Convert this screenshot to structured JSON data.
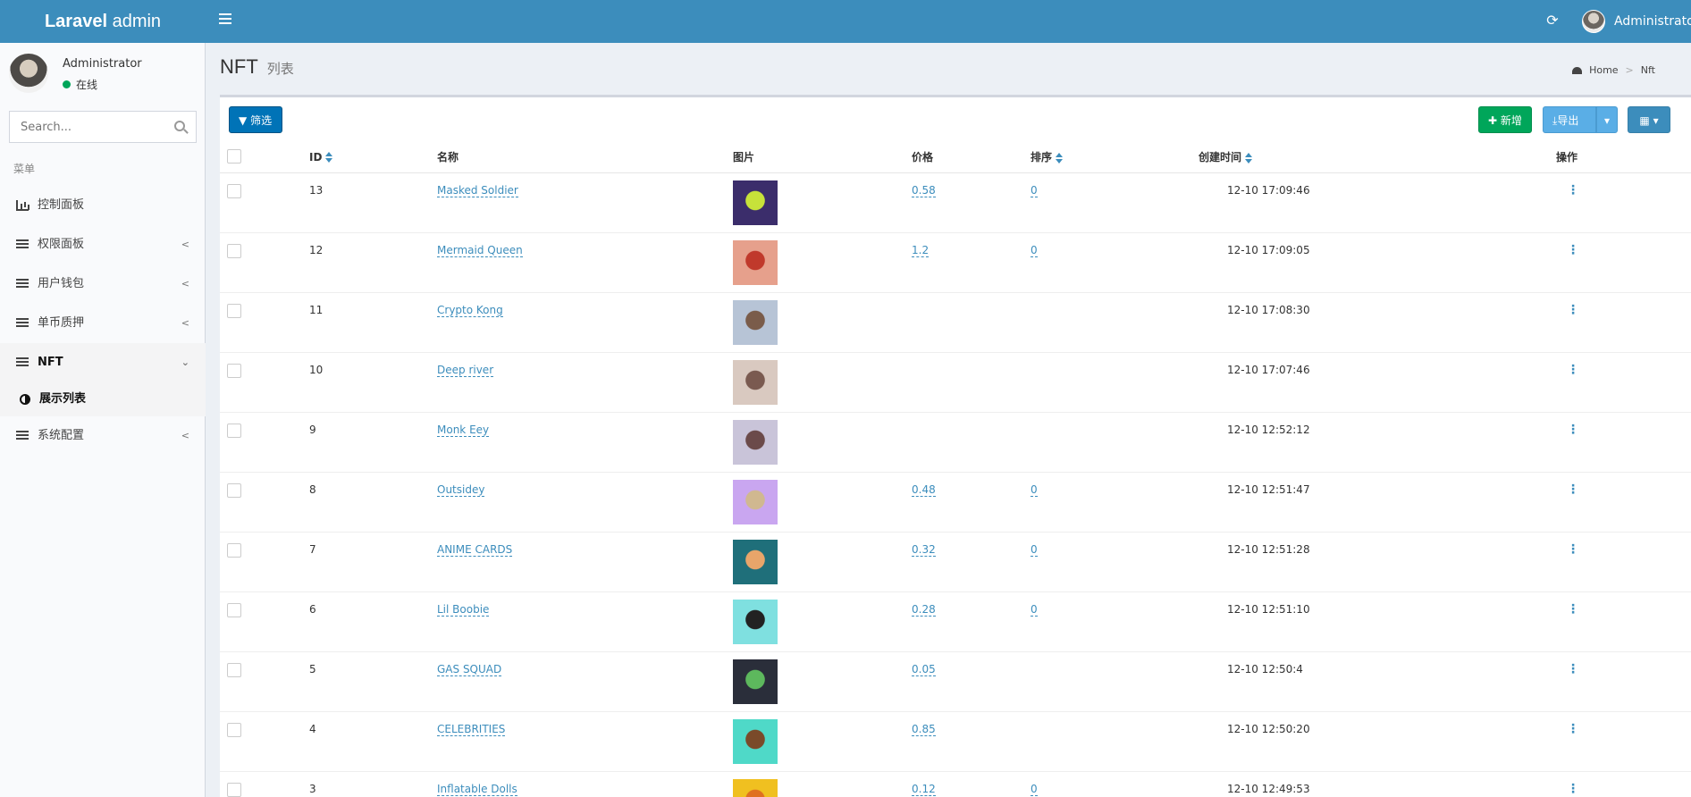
{
  "header": {
    "logo_bold": "Laravel",
    "logo_rest": " admin",
    "user_name": "Administrator"
  },
  "sidebar": {
    "user_name": "Administrator",
    "status": "在线",
    "search_placeholder": "Search...",
    "menu_header": "菜单",
    "items": [
      {
        "label": "控制面板"
      },
      {
        "label": "权限面板"
      },
      {
        "label": "用户钱包"
      },
      {
        "label": "单币质押"
      },
      {
        "label": "NFT"
      },
      {
        "label": "展示列表"
      },
      {
        "label": "系统配置"
      }
    ]
  },
  "content": {
    "title": "NFT",
    "subtitle": "列表",
    "breadcrumb": [
      "Home",
      "Nft"
    ]
  },
  "toolbar": {
    "filter": "筛选",
    "new": "新增",
    "export": "导出"
  },
  "table": {
    "headers": [
      "ID",
      "名称",
      "图片",
      "价格",
      "排序",
      "创建时间",
      "操作"
    ],
    "rows": [
      {
        "id": "13",
        "name": "Masked Soldier",
        "price": "0.58",
        "sort": "0",
        "time": "12-10 17:09:46",
        "c1": "#3b2d6b",
        "c2": "#c7e23a"
      },
      {
        "id": "12",
        "name": "Mermaid Queen",
        "price": "1.2",
        "sort": "0",
        "time": "12-10 17:09:05",
        "c1": "#e6a08c",
        "c2": "#c0392b"
      },
      {
        "id": "11",
        "name": "Crypto Kong",
        "price": "",
        "sort": "",
        "time": "12-10 17:08:30",
        "c1": "#b7c4d6",
        "c2": "#7a5c4a"
      },
      {
        "id": "10",
        "name": "Deep river",
        "price": "",
        "sort": "",
        "time": "12-10 17:07:46",
        "c1": "#d9c9c0",
        "c2": "#7a5a50"
      },
      {
        "id": "9",
        "name": "Monk Eey",
        "price": "",
        "sort": "",
        "time": "12-10 12:52:12",
        "c1": "#c9c4d9",
        "c2": "#6b4a4a"
      },
      {
        "id": "8",
        "name": "Outsidey",
        "price": "0.48",
        "sort": "0",
        "time": "12-10 12:51:47",
        "c1": "#c9a6f0",
        "c2": "#d0b890"
      },
      {
        "id": "7",
        "name": "ANIME CARDS",
        "price": "0.32",
        "sort": "0",
        "time": "12-10 12:51:28",
        "c1": "#1f6f7a",
        "c2": "#e8a56a"
      },
      {
        "id": "6",
        "name": "Lil Boobie",
        "price": "0.28",
        "sort": "0",
        "time": "12-10 12:51:10",
        "c1": "#7fe0e0",
        "c2": "#222222"
      },
      {
        "id": "5",
        "name": "GAS SQUAD",
        "price": "0.05",
        "sort": "",
        "time": "12-10 12:50:4",
        "c1": "#2a2e3a",
        "c2": "#5db85d"
      },
      {
        "id": "4",
        "name": "CELEBRITIES",
        "price": "0.85",
        "sort": "",
        "time": "12-10 12:50:20",
        "c1": "#4fd9c8",
        "c2": "#7a4a2a"
      },
      {
        "id": "3",
        "name": "Inflatable Dolls",
        "price": "0.12",
        "sort": "0",
        "time": "12-10 12:49:53",
        "c1": "#f0c020",
        "c2": "#e07020"
      }
    ]
  },
  "colors": {
    "header_bg": "#3c8dbc",
    "link": "#3c8dbc",
    "btn_new": "#00a65a",
    "btn_filter": "#0073b7",
    "status_online": "#00a65a"
  }
}
